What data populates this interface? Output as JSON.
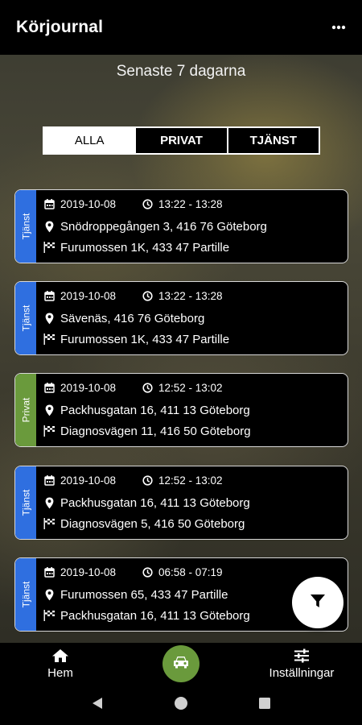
{
  "app": {
    "title": "Körjournal"
  },
  "header": {
    "subtitle": "Senaste 7 dagarna"
  },
  "filters": {
    "all": "ALLA",
    "private": "PRIVAT",
    "business": "TJÄNST"
  },
  "colors": {
    "business": "#2f6fe0",
    "private": "#6a9a3c",
    "accent_car": "#6a9a3c"
  },
  "trips": [
    {
      "type": "Tjänst",
      "date": "2019-10-08",
      "time": "13:22 - 13:28",
      "from": "Snödroppegången 3, 416 76 Göteborg",
      "to": "Furumossen 1K, 433 47 Partille"
    },
    {
      "type": "Tjänst",
      "date": "2019-10-08",
      "time": "13:22 - 13:28",
      "from": "Sävenäs, 416 76 Göteborg",
      "to": "Furumossen 1K, 433 47 Partille"
    },
    {
      "type": "Privat",
      "date": "2019-10-08",
      "time": "12:52 - 13:02",
      "from": "Packhusgatan 16, 411 13 Göteborg",
      "to": "Diagnosvägen 11, 416 50 Göteborg"
    },
    {
      "type": "Tjänst",
      "date": "2019-10-08",
      "time": "12:52 - 13:02",
      "from": "Packhusgatan 16, 411 13 Göteborg",
      "to": "Diagnosvägen 5, 416 50 Göteborg"
    },
    {
      "type": "Tjänst",
      "date": "2019-10-08",
      "time": "06:58 - 07:19",
      "from": "Furumossen 65, 433 47 Partille",
      "to": "Packhusgatan 16, 411 13 Göteborg"
    }
  ],
  "nav": {
    "home": "Hem",
    "settings": "Inställningar"
  },
  "icons": {
    "menu": "more-vert-icon",
    "filter": "filter-icon",
    "home": "home-icon",
    "car": "car-icon",
    "settings": "sliders-icon"
  }
}
